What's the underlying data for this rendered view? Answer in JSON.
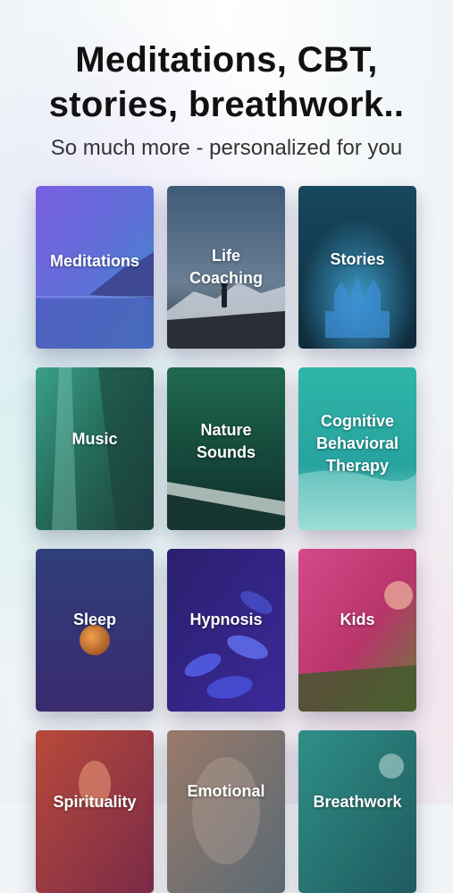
{
  "header": {
    "title_line1": "Meditations, CBT,",
    "title_line2": "stories, breathwork..",
    "subtitle": "So much more - personalized for you"
  },
  "categories": [
    {
      "label_lines": [
        "Meditations"
      ],
      "image": "lake-mountain",
      "color": "#6a5fd8"
    },
    {
      "label_lines": [
        "Life",
        "Coaching"
      ],
      "image": "person-on-mountain",
      "color": "#4a5f7a"
    },
    {
      "label_lines": [
        "Stories"
      ],
      "image": "glowing-castle",
      "color": "#1f5c73"
    },
    {
      "label_lines": [
        "Music"
      ],
      "image": "waterfall-forest",
      "color": "#2f8a72"
    },
    {
      "label_lines": [
        "Nature",
        "Sounds"
      ],
      "image": "rain-on-rail",
      "color": "#1f6a4f"
    },
    {
      "label_lines": [
        "Cognitive",
        "Behavioral",
        "Therapy"
      ],
      "image": "turquoise-water",
      "color": "#2fb5a8"
    },
    {
      "label_lines": [
        "Sleep"
      ],
      "image": "moon-night",
      "color": "#3b3a8a"
    },
    {
      "label_lines": [
        "Hypnosis"
      ],
      "image": "blue-leaves",
      "color": "#3a2a8a"
    },
    {
      "label_lines": [
        "Kids"
      ],
      "image": "child-in-meadow",
      "color": "#c23d78"
    },
    {
      "label_lines": [
        "Spirituality"
      ],
      "image": "candle-glow",
      "color": "#b84a3a"
    },
    {
      "label_lines": [
        "Emotional"
      ],
      "image": "misty-portrait",
      "color": "#8a7a6e"
    },
    {
      "label_lines": [
        "Breathwork"
      ],
      "image": "teal-dandelion",
      "color": "#2f8f86"
    }
  ]
}
